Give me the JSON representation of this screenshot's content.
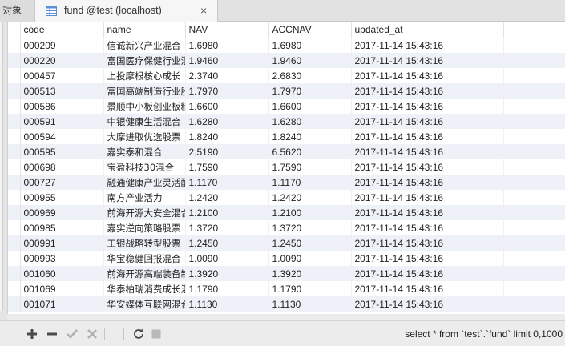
{
  "tabs": {
    "objects_label": "对象",
    "query_tab_title": "fund @test (localhost)",
    "close_glyph": "×"
  },
  "table": {
    "columns": [
      "code",
      "name",
      "NAV",
      "ACCNAV",
      "updated_at"
    ],
    "rows": [
      [
        "000209",
        "信诚新兴产业混合",
        "1.6980",
        "1.6980",
        "2017-11-14 15:43:16"
      ],
      [
        "000220",
        "富国医疗保健行业混",
        "1.9460",
        "1.9460",
        "2017-11-14 15:43:16"
      ],
      [
        "000457",
        "上投摩根核心成长",
        "2.3740",
        "2.6830",
        "2017-11-14 15:43:16"
      ],
      [
        "000513",
        "富国高端制造行业股",
        "1.7970",
        "1.7970",
        "2017-11-14 15:43:16"
      ],
      [
        "000586",
        "景顺中小板创业板精",
        "1.6600",
        "1.6600",
        "2017-11-14 15:43:16"
      ],
      [
        "000591",
        "中银健康生活混合",
        "1.6280",
        "1.6280",
        "2017-11-14 15:43:16"
      ],
      [
        "000594",
        "大摩进取优选股票",
        "1.8240",
        "1.8240",
        "2017-11-14 15:43:16"
      ],
      [
        "000595",
        "嘉实泰和混合",
        "2.5190",
        "6.5620",
        "2017-11-14 15:43:16"
      ],
      [
        "000698",
        "宝盈科技30混合",
        "1.7590",
        "1.7590",
        "2017-11-14 15:43:16"
      ],
      [
        "000727",
        "融通健康产业灵活配",
        "1.1170",
        "1.1170",
        "2017-11-14 15:43:16"
      ],
      [
        "000955",
        "南方产业活力",
        "1.2420",
        "1.2420",
        "2017-11-14 15:43:16"
      ],
      [
        "000969",
        "前海开源大安全混合",
        "1.2100",
        "1.2100",
        "2017-11-14 15:43:16"
      ],
      [
        "000985",
        "嘉实逆向策略股票",
        "1.3720",
        "1.3720",
        "2017-11-14 15:43:16"
      ],
      [
        "000991",
        "工银战略转型股票",
        "1.2450",
        "1.2450",
        "2017-11-14 15:43:16"
      ],
      [
        "000993",
        "华宝稳健回报混合",
        "1.0090",
        "1.0090",
        "2017-11-14 15:43:16"
      ],
      [
        "001060",
        "前海开源高端装备制",
        "1.3920",
        "1.3920",
        "2017-11-14 15:43:16"
      ],
      [
        "001069",
        "华泰柏瑞消费成长混",
        "1.1790",
        "1.1790",
        "2017-11-14 15:43:16"
      ],
      [
        "001071",
        "华安媒体互联网混合",
        "1.1130",
        "1.1130",
        "2017-11-14 15:43:16"
      ]
    ]
  },
  "toolbar": {
    "add_icon": "plus-icon",
    "delete_icon": "minus-icon",
    "apply_icon": "checkmark-icon",
    "discard_icon": "cross-icon",
    "refresh_icon": "refresh-icon",
    "stop_icon": "stop-icon",
    "sql_text": "select * from `test`.`fund` limit 0,1000"
  },
  "colors": {
    "stripe": "#eef1f8",
    "tab_active": "#f6f6f6",
    "toolbar_bg": "#ececec"
  }
}
